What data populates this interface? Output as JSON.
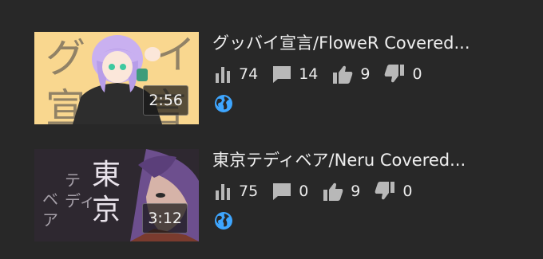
{
  "videos": [
    {
      "title": "グッバイ宣言/FloweR Covered...",
      "duration": "2:56",
      "thumb_text": "グッバイ宣言",
      "stats": {
        "views": "74",
        "comments": "14",
        "likes": "9",
        "dislikes": "0"
      },
      "visibility_icon": "globe-icon"
    },
    {
      "title": "東京テディベア/Neru Covered...",
      "duration": "3:12",
      "thumb_text": "東京テディベア",
      "stats": {
        "views": "75",
        "comments": "0",
        "likes": "9",
        "dislikes": "0"
      },
      "visibility_icon": "globe-icon"
    }
  ],
  "colors": {
    "background": "#282828",
    "text": "#ececec",
    "icon": "#b8b8b8",
    "globe": "#3ea6ff",
    "thumb1_bg": "#f9d78f",
    "thumb2_bg": "#29252b"
  }
}
